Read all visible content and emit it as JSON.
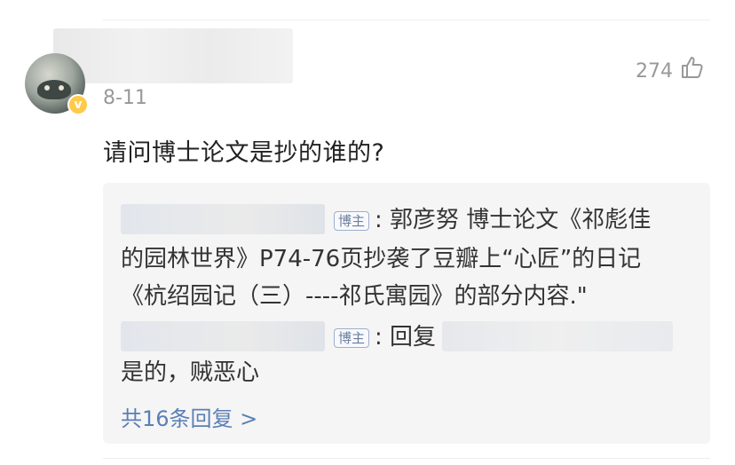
{
  "comment": {
    "date": "8-11",
    "like_count": "274",
    "text": "请问博士论文是抄的谁的?",
    "verified_badge": "v"
  },
  "replies": [
    {
      "author_badge": "博主",
      "line1": ": 郭彦努 博士论文《祁彪佳",
      "line2": "的园林世界》P74-76页抄袭了豆瓣上“心匠”的日记",
      "line3": "《杭绍园记（三）----祁氏寓园》的部分内容.\""
    },
    {
      "author_badge": "博主",
      "prefix": ": 回复",
      "text": "是的，贼恶心"
    }
  ],
  "more_replies_label": "共16条回复 >",
  "colors": {
    "link": "#5b7fb5",
    "verified": "#ffc94a",
    "reply_bg": "#f5f5f5",
    "meta": "#999999"
  },
  "icons": {
    "like": "thumbs-up-icon"
  }
}
